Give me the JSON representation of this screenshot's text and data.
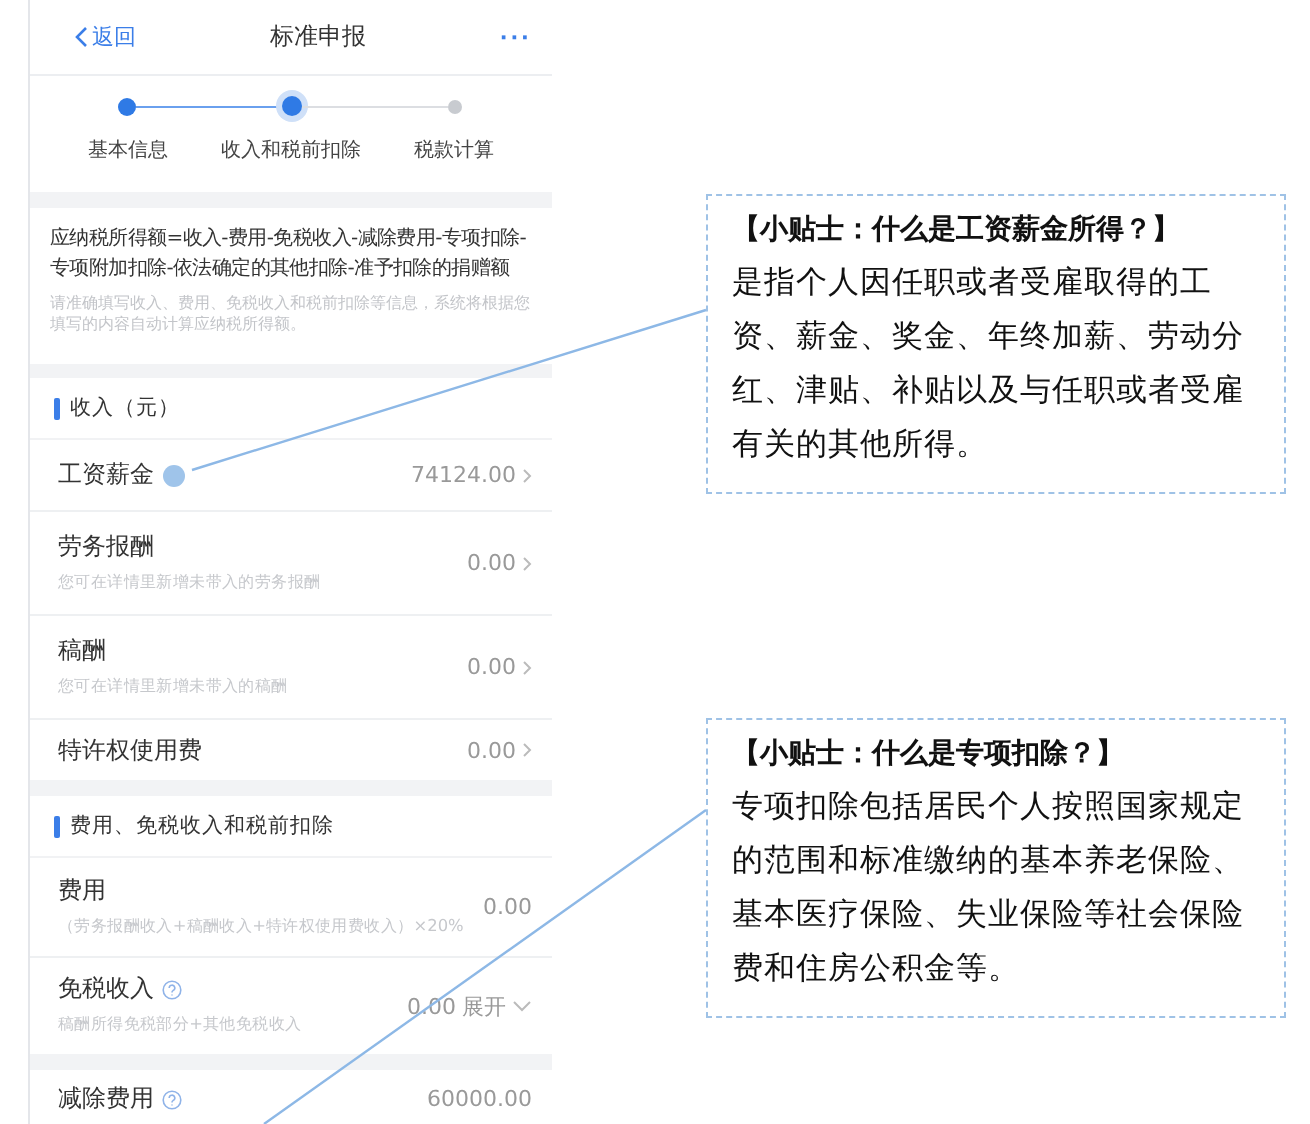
{
  "nav": {
    "back": "返回",
    "title": "标准申报",
    "more": "···"
  },
  "steps": [
    {
      "label": "基本信息",
      "done": true,
      "selected": false
    },
    {
      "label": "收入和税前扣除",
      "done": true,
      "selected": true
    },
    {
      "label": "税款计算",
      "done": false,
      "selected": false
    }
  ],
  "formula": {
    "text": "应纳税所得额=收入-费用-免税收入-减除费用-专项扣除-专项附加扣除-依法确定的其他扣除-准予扣除的捐赠额",
    "hint": "请准确填写收入、费用、免税收入和税前扣除等信息，系统将根据您填写的内容自动计算应纳税所得额。"
  },
  "sections": [
    {
      "title": "收入（元）",
      "rows": [
        {
          "label": "工资薪金",
          "value": "74124.00",
          "kind": "link",
          "annotated": true
        },
        {
          "label": "劳务报酬",
          "value": "0.00",
          "kind": "link",
          "hint": "您可在详情里新增未带入的劳务报酬"
        },
        {
          "label": "稿酬",
          "value": "0.00",
          "kind": "link",
          "hint": "您可在详情里新增未带入的稿酬"
        },
        {
          "label": "特许权使用费",
          "value": "0.00",
          "kind": "link"
        }
      ]
    },
    {
      "title": "费用、免税收入和税前扣除",
      "rows": [
        {
          "label": "费用",
          "value": "0.00",
          "kind": "plain",
          "hint": "（劳务报酬收入+稿酬收入+特许权使用费收入）×20%"
        },
        {
          "label": "免税收入",
          "value": "0.00",
          "kind": "expand",
          "action": "展开",
          "help": true,
          "hint": "稿酬所得免税部分+其他免税收入"
        }
      ]
    },
    {
      "rows": [
        {
          "label": "减除费用",
          "value": "60000.00",
          "kind": "plain",
          "help": true
        }
      ]
    }
  ],
  "callouts": [
    {
      "title": "【小贴士：什么是工资薪金所得？】",
      "body": "是指个人因任职或者受雇取得的工资、薪金、奖金、年终加薪、劳动分红、津贴、补贴以及与任职或者受雇有关的其他所得。"
    },
    {
      "title": "【小贴士：什么是专项扣除？】",
      "body": "专项扣除包括居民个人按照国家规定的范围和标准缴纳的基本养老保险、基本医疗保险、失业保险等社会保险费和住房公积金等。"
    }
  ]
}
